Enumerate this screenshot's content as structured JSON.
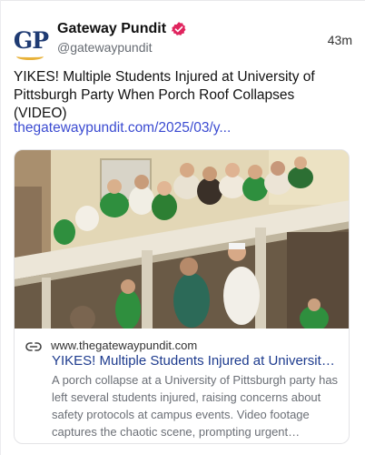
{
  "author": {
    "display_name": "Gateway Pundit",
    "handle": "@gatewaypundit",
    "avatar_text": "GP",
    "verified": true
  },
  "timestamp": "43m",
  "post": {
    "text": "YIKES! Multiple Students Injured at University of Pittsburgh Party When Porch Roof Collapses (VIDEO)",
    "link_text": "thegatewaypundit.com/2025/03/y..."
  },
  "card": {
    "image_icon": "porch-collapse-photo",
    "link_icon": "link-icon",
    "domain": "www.thegatewaypundit.com",
    "title": "YIKES! Multiple Students Injured at University of Pittsburgh Party When Porch Roof Collapses (VIDEO)",
    "description": "A porch collapse at a University of Pittsburgh party has left several students injured, raising concerns about safety protocols at campus events. Video footage captures the chaotic scene, prompting urgent discussions about safety."
  },
  "colors": {
    "link": "#3b4bd1",
    "card_title": "#1d3b8e",
    "verified_badge": "#e0245e",
    "avatar_text": "#1f3b73"
  }
}
